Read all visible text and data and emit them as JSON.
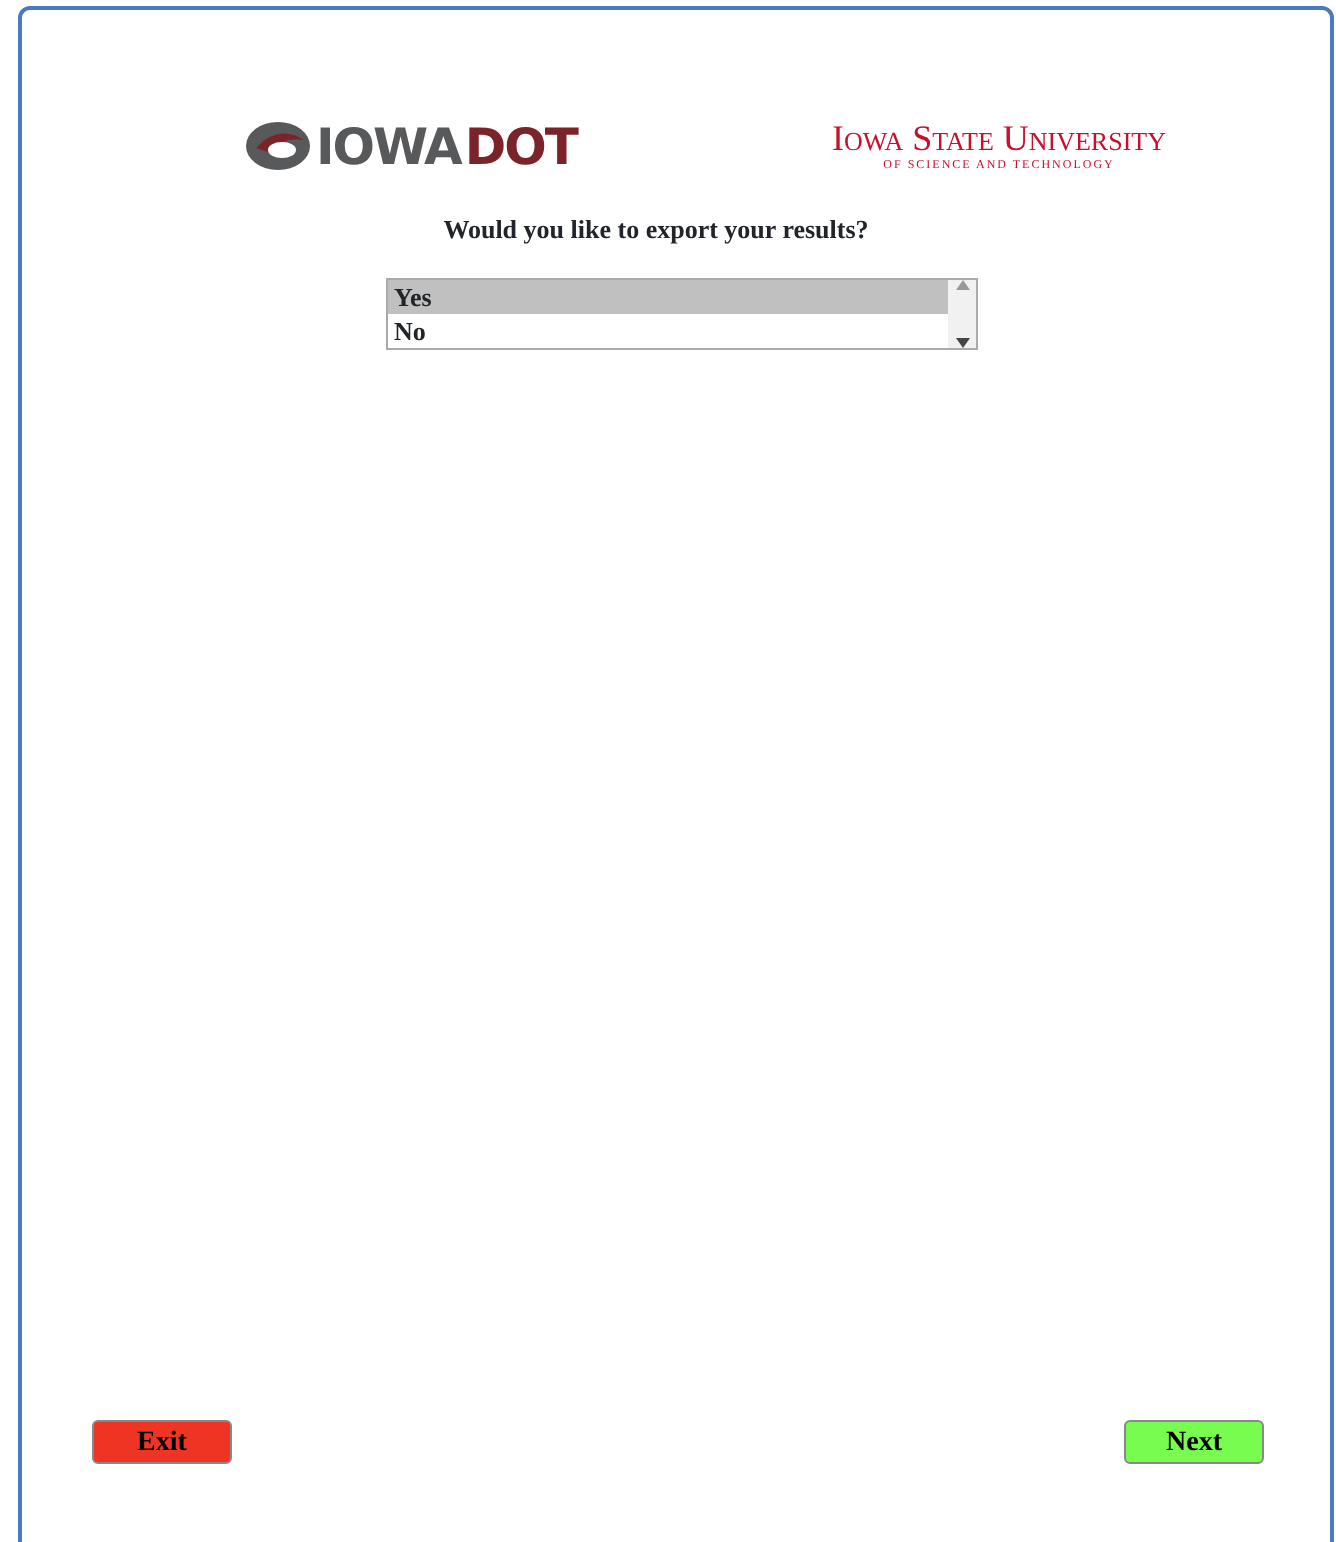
{
  "logos": {
    "dot": {
      "first": "IOWA",
      "second": "DOT"
    },
    "university": {
      "name": "Iowa State University",
      "tagline": "OF SCIENCE AND TECHNOLOGY"
    }
  },
  "question": "Would you like to export your results?",
  "options": [
    {
      "label": "Yes",
      "selected": true
    },
    {
      "label": "No",
      "selected": false
    }
  ],
  "buttons": [
    {
      "label": "Exit",
      "color": "#ee3524"
    },
    {
      "label": "Next",
      "color": "#77fc4f"
    }
  ]
}
